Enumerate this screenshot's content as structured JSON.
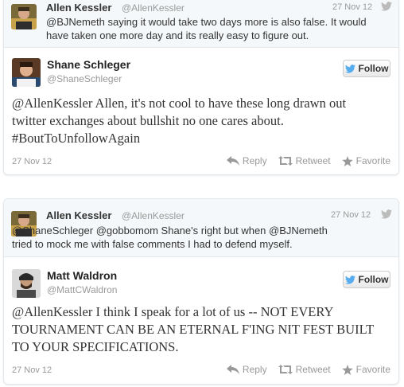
{
  "thread1": {
    "reply": {
      "name": "Allen Kessler",
      "handle": "@AllenKessler",
      "date": "27 Nov 12",
      "line1": "@BJNemeth saying it would take two days more is also false. It would",
      "line2": "have taken one more day and its really easy to figure out."
    },
    "main": {
      "name": "Shane Schleger",
      "handle": "@ShaneSchleger",
      "follow_label": "Follow",
      "line1": "@AllenKessler Allen, it's not cool to have these long drawn out",
      "line2": "twitter exchanges about bullshit no one cares about.",
      "line3": "#BoutToUnfollowAgain",
      "date": "27 Nov 12",
      "reply_label": "Reply",
      "retweet_label": "Retweet",
      "favorite_label": "Favorite"
    }
  },
  "thread2": {
    "reply": {
      "name": "Allen Kessler",
      "handle": "@AllenKessler",
      "date": "27 Nov 12",
      "line1": "@ShaneSchleger @gobbomom Shane's right but when @BJNemeth",
      "line2": "tried to mock me with false comments I had to defend myself."
    },
    "main": {
      "name": "Matt Waldron",
      "handle": "@MattCWaldron",
      "follow_label": "Follow",
      "line1": "@AllenKessler I think I speak for a lot of us -- NOT EVERY",
      "line2": "TOURNAMENT CAN BE AN ETERNAL F'ING NIT FEST BUILT",
      "line3": "TO YOUR SPECIFICATIONS.",
      "date": "27 Nov 12",
      "reply_label": "Reply",
      "retweet_label": "Retweet",
      "favorite_label": "Favorite"
    }
  },
  "colors": {
    "border": "#e1e8ed",
    "reply_bg": "#f5f8fa",
    "muted": "#999999",
    "twitter_blue": "#55acee"
  },
  "icons": [
    "twitter-bird-icon",
    "reply-icon",
    "retweet-icon",
    "favorite-star-icon",
    "avatar"
  ]
}
